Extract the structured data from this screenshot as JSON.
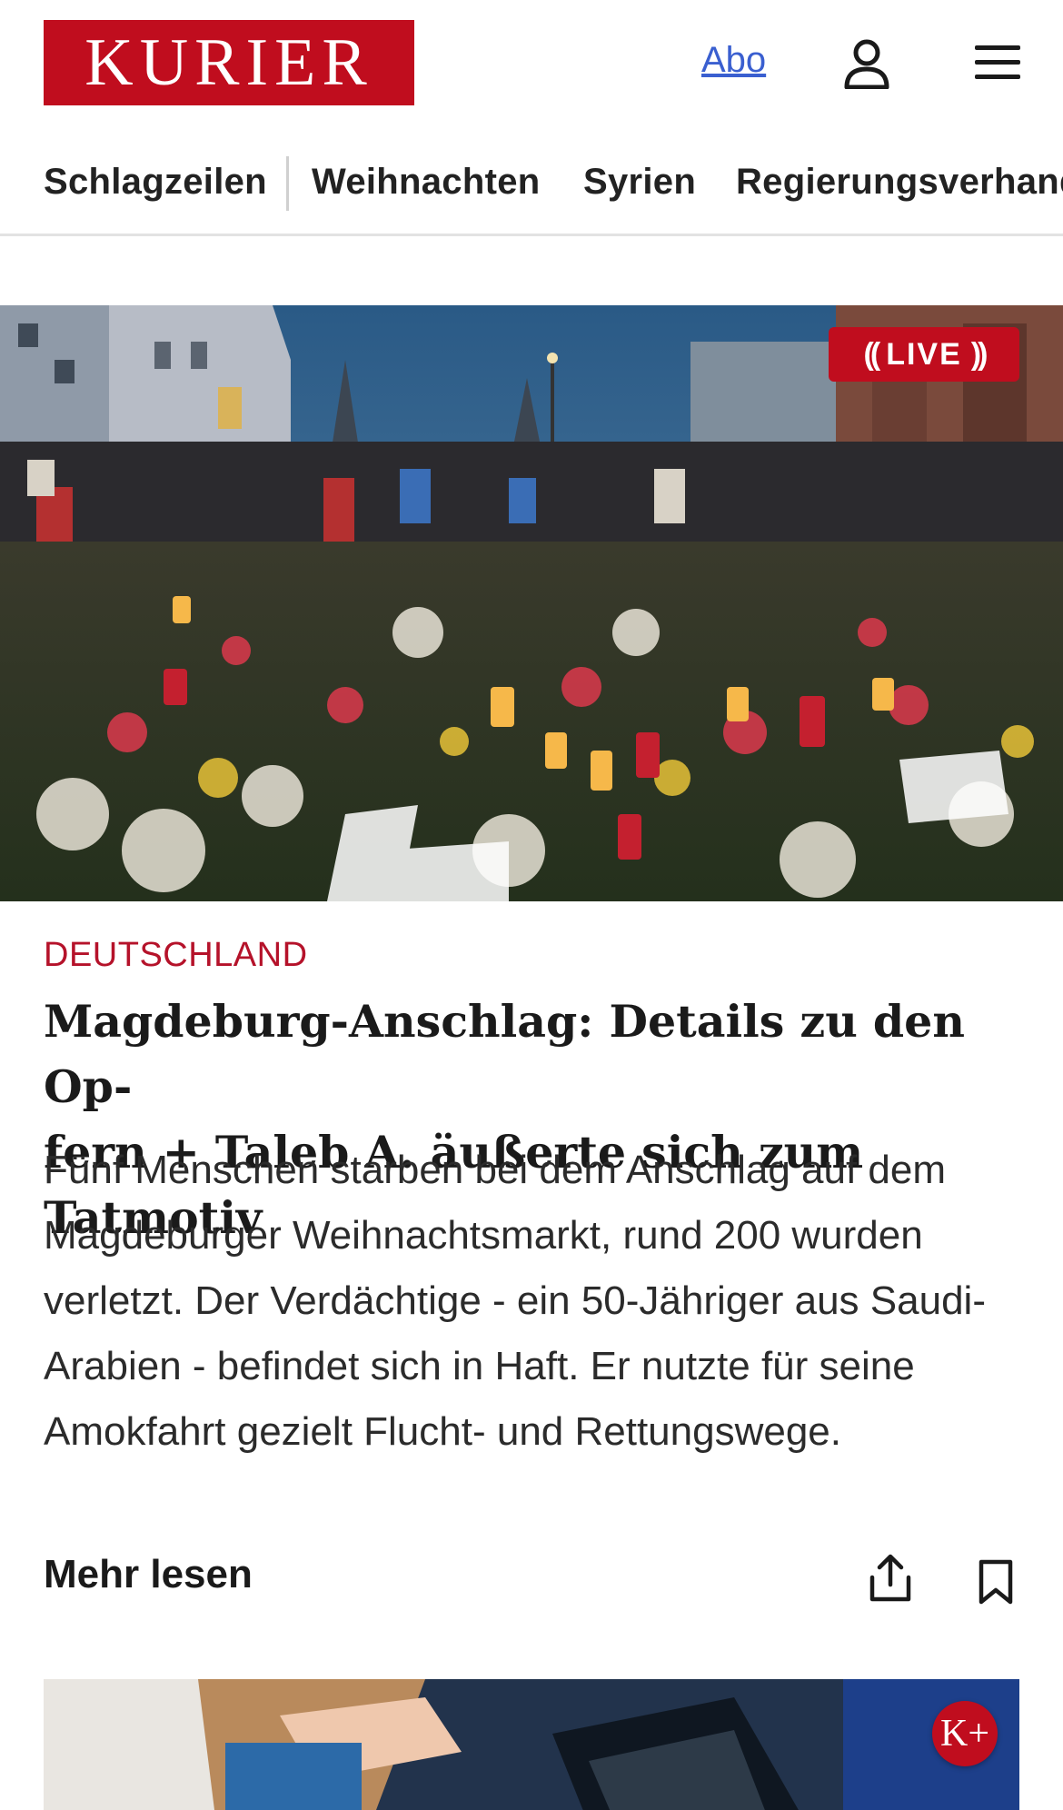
{
  "header": {
    "logo_text": "KURIER",
    "abo_label": "Abo",
    "brand_color": "#c00d1e"
  },
  "nav": {
    "items": [
      {
        "label": "Schlagzeilen"
      },
      {
        "label": "Weihnachten"
      },
      {
        "label": "Syrien"
      },
      {
        "label": "Regierungsverhand"
      }
    ]
  },
  "hero": {
    "live_label": "LIVE",
    "live_left": "((",
    "live_right": "))"
  },
  "article": {
    "kicker": "DEUTSCHLAND",
    "headline_line1": "Magdeburg-Anschlag: Details zu den Op-",
    "headline_line2": "fern + Taleb A. äußerte sich zum Tatmotiv",
    "teaser": "Fünf Menschen starben bei dem Anschlag auf dem Magdeburger Weihnachtsmarkt, rund 200 wurden verletzt. Der Verdächtige - ein 50-Jähriger aus Saudi-Arabien - befindet sich in Haft. Er nutzte für seine Amokfahrt gezielt Flucht- und Rettungswege.",
    "more_label": "Mehr lesen"
  },
  "next_card": {
    "badge": "K+"
  },
  "icons": {
    "user": "user-icon",
    "menu": "menu-icon",
    "share": "share-icon",
    "bookmark": "bookmark-icon"
  }
}
